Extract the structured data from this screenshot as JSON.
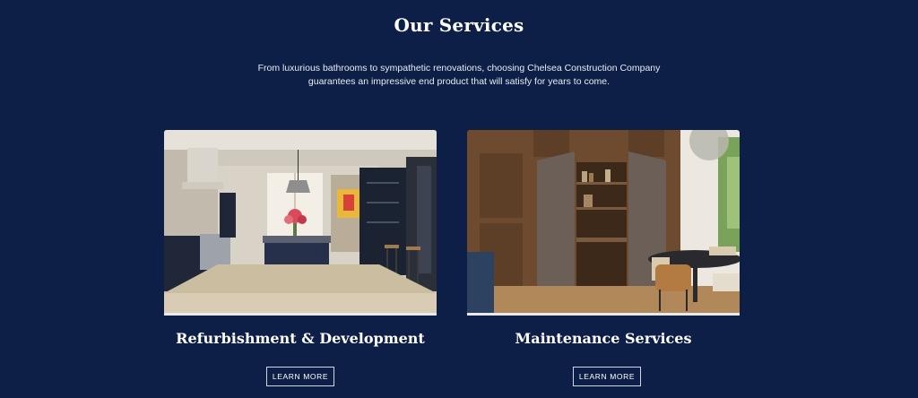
{
  "services": {
    "title": "Our Services",
    "intro": "From luxurious bathrooms to sympathetic renovations, choosing Chelsea Construction Company guarantees an impressive end product that will satisfy for years to come.",
    "cards": [
      {
        "title": "Refurbishment & Development",
        "button": "LEARN MORE",
        "image_icon": "kitchen-photo"
      },
      {
        "title": "Maintenance Services",
        "button": "LEARN MORE",
        "image_icon": "dining-room-photo"
      }
    ]
  },
  "colors": {
    "background": "#0d1f47",
    "text": "#ffffff",
    "button_border": "#cfd6e4"
  }
}
